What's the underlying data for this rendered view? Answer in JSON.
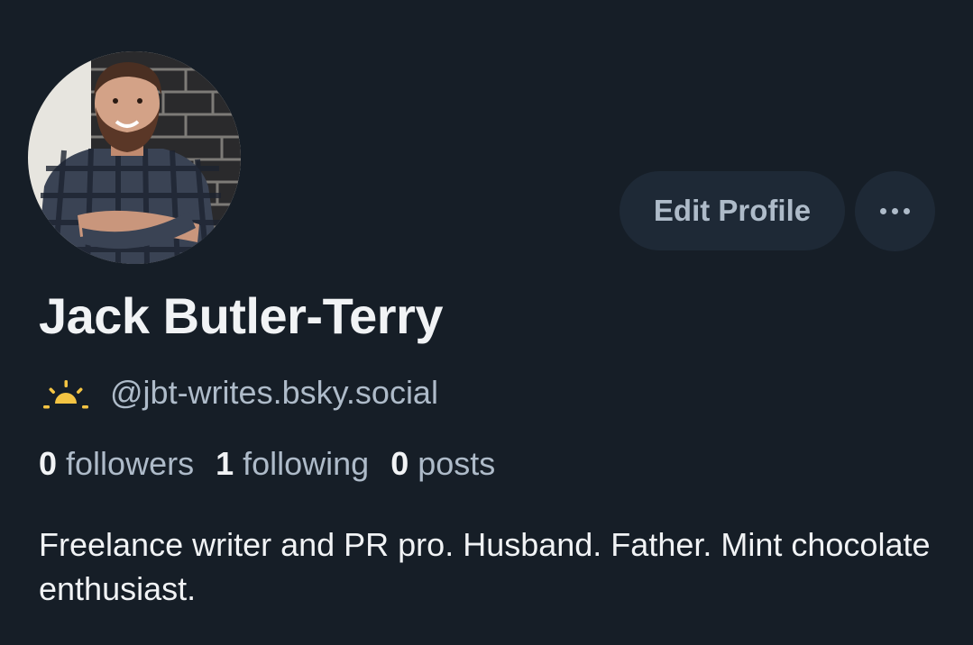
{
  "profile": {
    "display_name": "Jack Butler-Terry",
    "handle": "@jbt-writes.bsky.social",
    "handle_icon": "sunrise-icon",
    "bio": "Freelance writer and PR pro. Husband. Father. Mint chocolate enthusiast.",
    "avatar_alt": "profile-photo"
  },
  "actions": {
    "edit_label": "Edit Profile",
    "more_icon": "ellipsis-icon"
  },
  "stats": {
    "followers_count": "0",
    "followers_label": "followers",
    "following_count": "1",
    "following_label": "following",
    "posts_count": "0",
    "posts_label": "posts"
  },
  "colors": {
    "background": "#161e27",
    "button_bg": "#1e2936",
    "muted_text": "#aebbc9",
    "primary_text": "#f1f3f5",
    "sun_icon": "#f4c443"
  }
}
